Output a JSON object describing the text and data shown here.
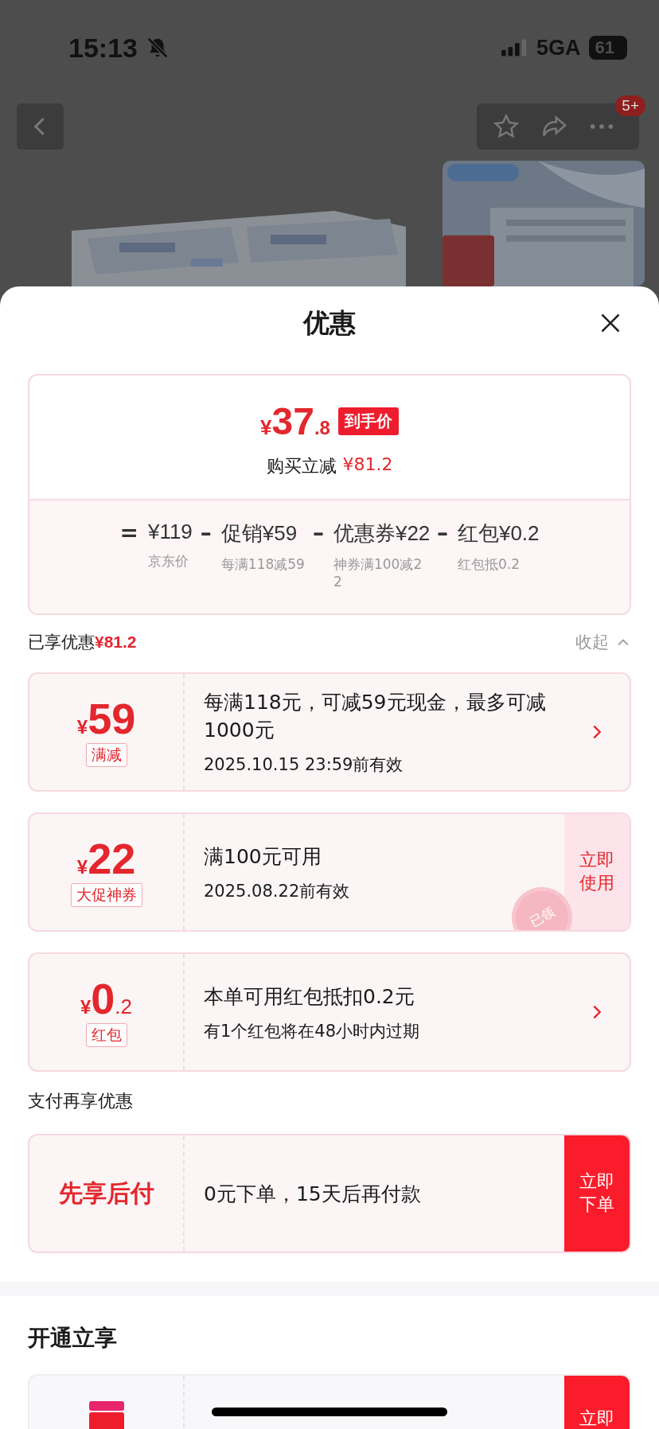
{
  "status_bar": {
    "time": "15:13",
    "network": "5GA",
    "battery": "61"
  },
  "header": {
    "badge": "5+"
  },
  "sheet": {
    "title": "优惠"
  },
  "price_card": {
    "currency": "¥",
    "integer": "37",
    "decimal": ".8",
    "tag": "到手价",
    "saving_label": "购买立减",
    "saving": "¥81.2",
    "breakdown": [
      {
        "sign": "=",
        "amount": "¥119",
        "note": "京东价"
      },
      {
        "sign": "–",
        "label": "促销",
        "amount": "¥59",
        "note": "每满118减59"
      },
      {
        "sign": "–",
        "label": "优惠券",
        "amount": "¥22",
        "note": "神券满100减22"
      },
      {
        "sign": "–",
        "label": "红包",
        "amount": "¥0.2",
        "note": "红包抵0.2"
      }
    ]
  },
  "enjoyed": {
    "label": "已享优惠",
    "amount": "¥81.2",
    "toggle": "收起"
  },
  "coupons": [
    {
      "kind": "arrow",
      "currency": "¥",
      "amount": "59",
      "tag": "满减",
      "text": "每满118元，可减59元现金，最多可减1000元",
      "validity": "2025.10.15 23:59前有效"
    },
    {
      "kind": "action",
      "currency": "¥",
      "amount": "22",
      "tag": "大促神券",
      "text": "满100元可用",
      "validity": "2025.08.22前有效",
      "action": "立即使用",
      "stamp": "已领"
    },
    {
      "kind": "arrow",
      "currency": "¥",
      "amount": "0",
      "decimal": ".2",
      "tag": "红包",
      "text": "本单可用红包抵扣0.2元",
      "validity": "有1个红包将在48小时内过期"
    }
  ],
  "pay_section": {
    "title": "支付再享优惠",
    "name": "先享后付",
    "text": "0元下单，15天后再付款",
    "action": "立即下单"
  },
  "open_section": {
    "title": "开通立享",
    "action": "立即"
  }
}
